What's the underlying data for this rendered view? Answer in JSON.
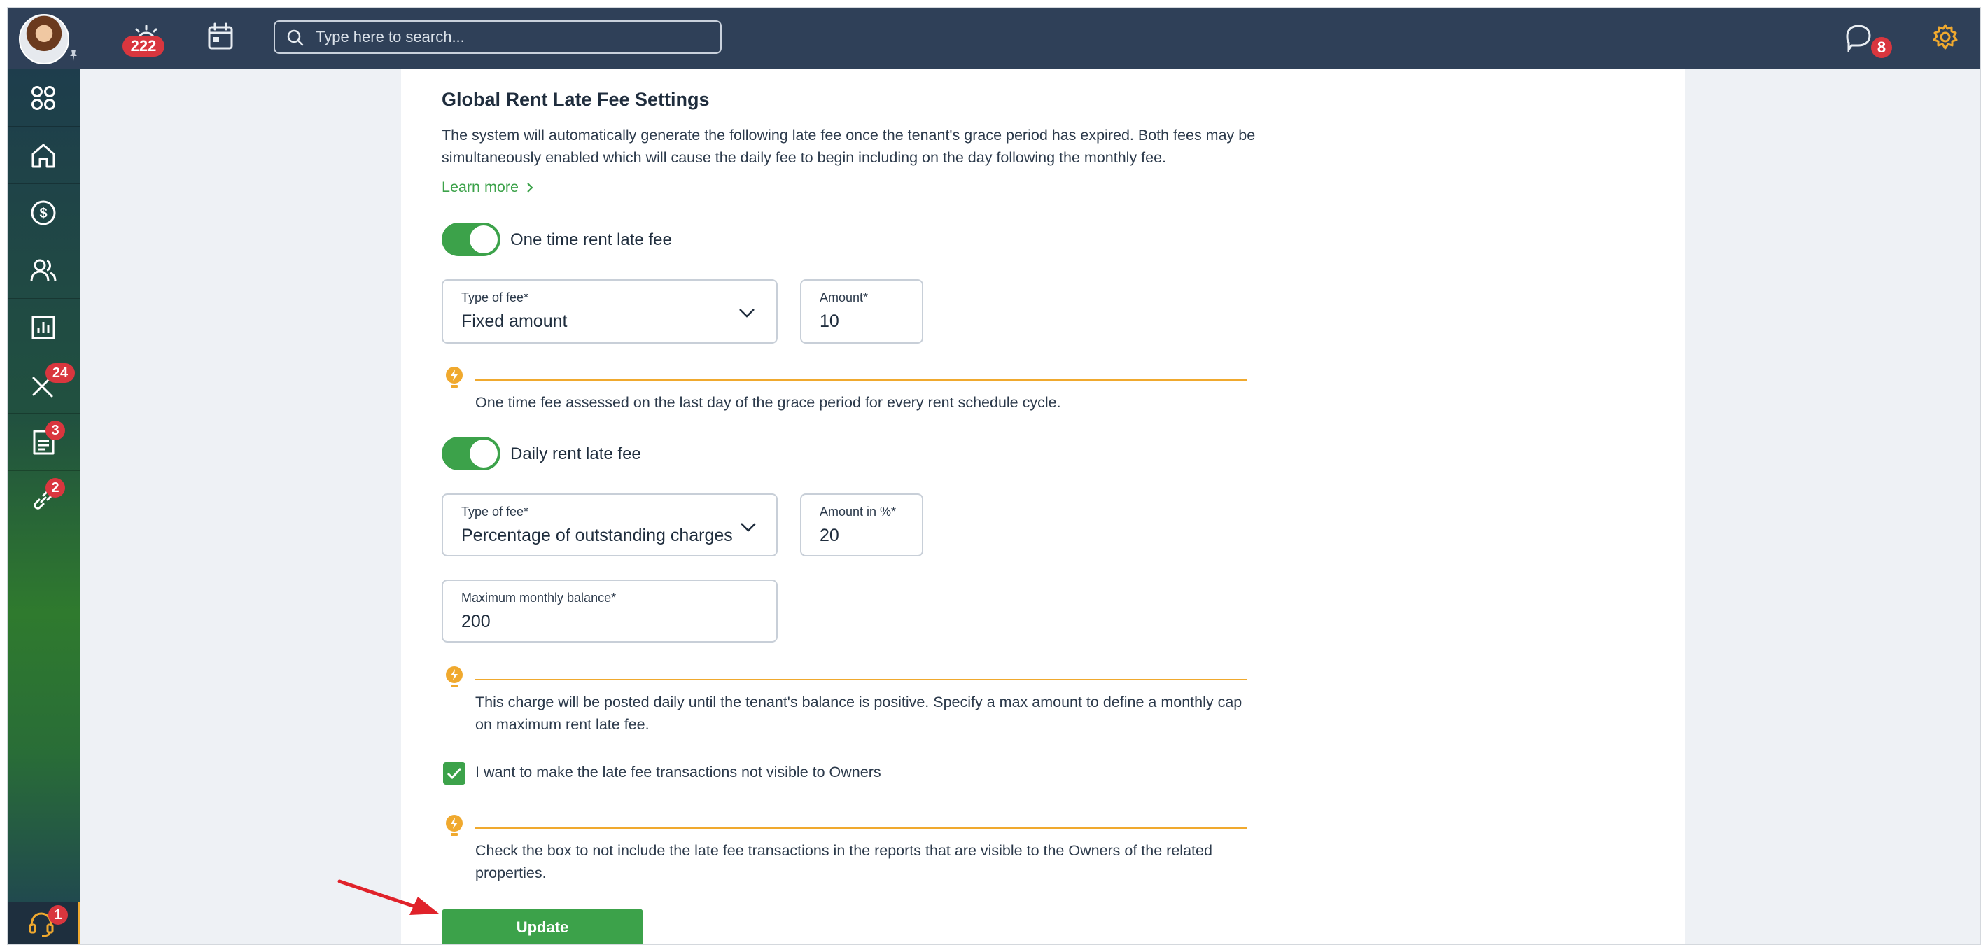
{
  "topbar": {
    "alerts_badge": "222",
    "search_placeholder": "Type here to search...",
    "messages_badge": "8"
  },
  "sidebar": {
    "items": [
      {
        "name": "dashboard",
        "badge": ""
      },
      {
        "name": "home",
        "badge": ""
      },
      {
        "name": "accounting",
        "badge": ""
      },
      {
        "name": "people",
        "badge": ""
      },
      {
        "name": "reports",
        "badge": ""
      },
      {
        "name": "maintenance",
        "badge": "24"
      },
      {
        "name": "documents",
        "badge": "3"
      },
      {
        "name": "links",
        "badge": "2"
      }
    ],
    "help_badge": "1"
  },
  "settings": {
    "title": "Global Rent Late Fee Settings",
    "description": "The system will automatically generate the following late fee once the tenant's grace period has expired. Both fees may be simultaneously enabled which will cause the daily fee to begin including on the day following the monthly fee.",
    "learn_more": "Learn more",
    "one_time": {
      "toggle_label": "One time rent late fee",
      "enabled": true,
      "type_label": "Type of fee*",
      "type_value": "Fixed amount",
      "amount_label": "Amount*",
      "amount_value": "10",
      "hint": "One time fee assessed on the last day of the grace period for every rent schedule cycle."
    },
    "daily": {
      "toggle_label": "Daily rent late fee",
      "enabled": true,
      "type_label": "Type of fee*",
      "type_value": "Percentage of outstanding charges",
      "amount_label": "Amount in %*",
      "amount_value": "20",
      "max_label": "Maximum monthly balance*",
      "max_value": "200",
      "hint": "This charge will be posted daily until the tenant's balance is positive. Specify a max amount to define a monthly cap on maximum rent late fee."
    },
    "owners": {
      "checkbox_label": "I want to make the late fee transactions not visible to Owners",
      "checked": true,
      "hint": "Check the box to not include the late fee transactions in the reports that are visible to the Owners of the related properties."
    },
    "update_label": "Update"
  },
  "colors": {
    "topbar": "#2f4058",
    "accent_green": "#3ca24a",
    "hint_orange": "#f0a92e",
    "badge_red": "#d9363e",
    "annotation_arrow": "#e0222a"
  }
}
